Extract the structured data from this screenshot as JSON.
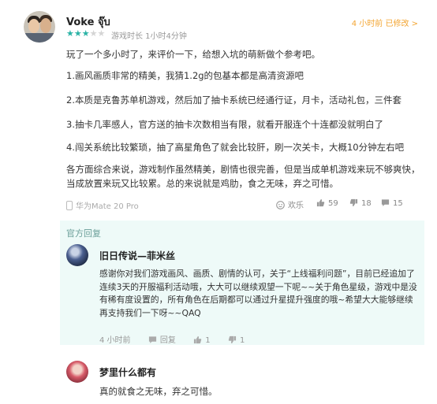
{
  "review": {
    "username": "Voke จุ๊บ",
    "rating": 3,
    "max_rating": 5,
    "meta": "游戏时长 1小时4分钟",
    "edit_info": "4 小时前 已修改 >",
    "paragraphs": [
      "玩了一个多小时了，来评价一下，给想入坑的萌新做个参考吧。",
      "1.画风画质非常的精美，我猜1.2g的包基本都是高清资源吧",
      "2.本质是克鲁苏单机游戏，然后加了抽卡系统已经通行证，月卡，活动礼包，三件套",
      "3.抽卡几率感人，官方送的抽卡次数相当有限，就看开服连个十连都没就明白了",
      "4.闯关系统比较繁琐，抽了高星角色了就会比较肝，刷一次关卡，大概10分钟左右吧",
      "各方面综合来说，游戏制作虽然精美，剧情也很完善，但是当成单机游戏来玩不够爽快，当成放置来玩又比较累。总的来说就是鸡肋，食之无味，弃之可惜。"
    ],
    "device": "华为Mate 20 Pro",
    "actions": {
      "happy": "欢乐",
      "likes": "59",
      "dislikes": "18",
      "comments": "15"
    }
  },
  "official_reply": {
    "header": "官方回复",
    "name": "旧日传说—菲米丝",
    "text": "感谢你对我们游戏画风、画质、剧情的认可，关于“上线福利问题”，目前已经追加了连续3天的开服福利活动哦，大大可以继续观望一下呢~~关于角色星级，游戏中是没有稀有度设置的，所有角色在后期都可以通过升星提升强度的哦~希望大大能够继续再支持我们一下呀~~QAQ",
    "time": "4 小时前",
    "reply_label": "回复",
    "likes": "1",
    "dislikes": "1"
  },
  "second_reply": {
    "name": "梦里什么都有",
    "text": "真的就食之无味，弃之可惜。"
  },
  "colors": {
    "accent": "#2bb3a6",
    "edit": "#f3a532",
    "reply_bg": "#eefaf8"
  }
}
